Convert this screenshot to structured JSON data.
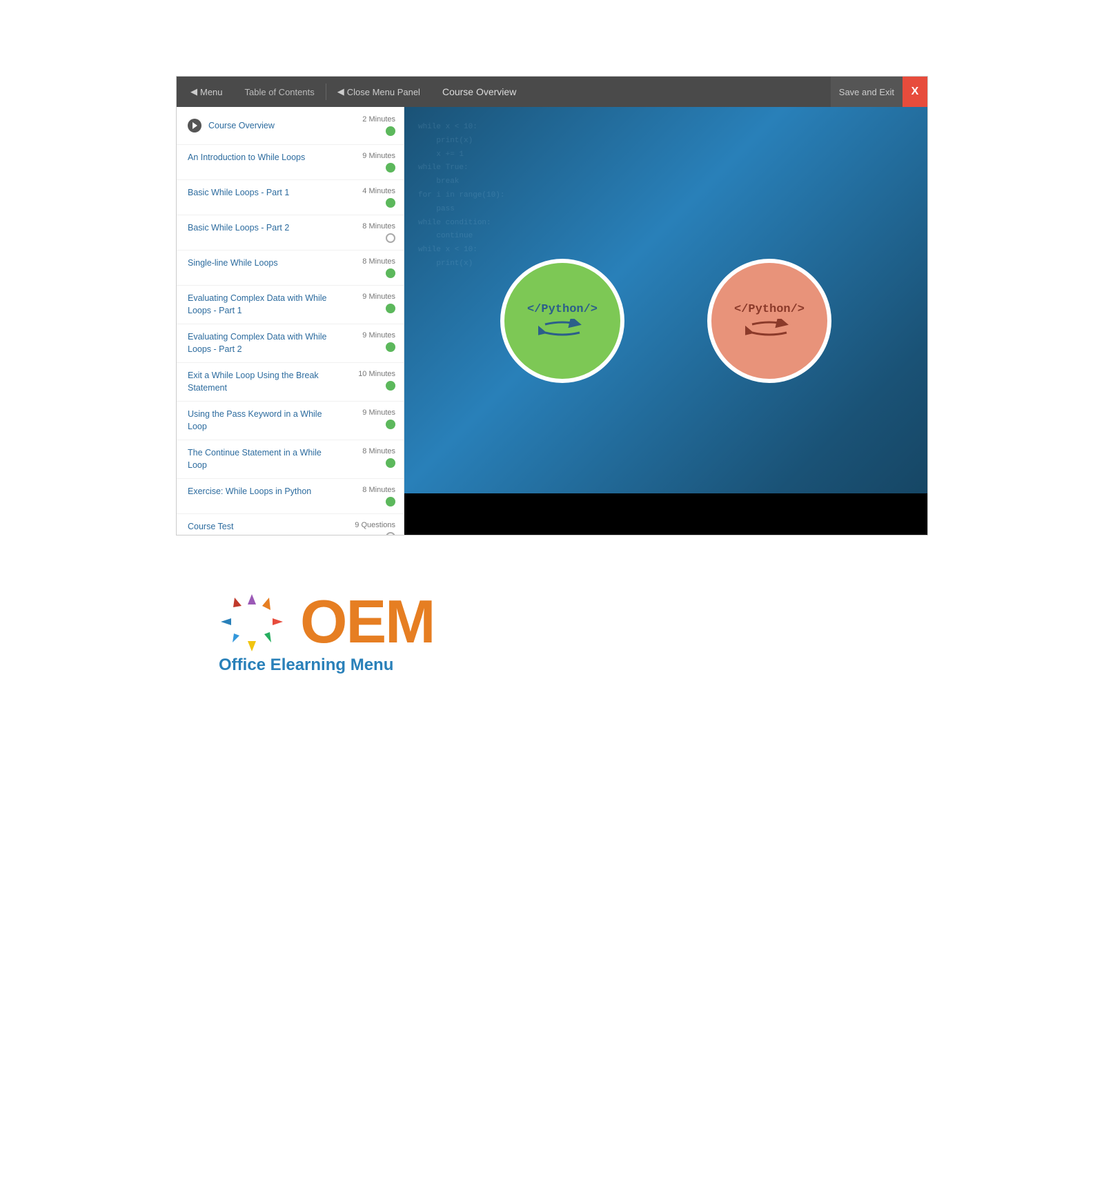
{
  "nav": {
    "menu_label": "Menu",
    "toc_label": "Table of Contents",
    "close_panel_label": "Close Menu Panel",
    "course_overview_label": "Course Overview",
    "save_exit_label": "Save and Exit",
    "close_x_label": "X"
  },
  "sidebar": {
    "items": [
      {
        "id": "course-overview",
        "label": "Course Overview",
        "duration": "2 Minutes",
        "status": "green",
        "active": true
      },
      {
        "id": "intro-while-loops",
        "label": "An Introduction to While Loops",
        "duration": "9 Minutes",
        "status": "green",
        "active": false
      },
      {
        "id": "basic-while-loops-1",
        "label": "Basic While Loops - Part 1",
        "duration": "4 Minutes",
        "status": "green",
        "active": false
      },
      {
        "id": "basic-while-loops-2",
        "label": "Basic While Loops - Part 2",
        "duration": "8 Minutes",
        "status": "empty",
        "active": false
      },
      {
        "id": "single-line-while-loops",
        "label": "Single-line While Loops",
        "duration": "8 Minutes",
        "status": "green",
        "active": false
      },
      {
        "id": "evaluating-complex-1",
        "label": "Evaluating Complex Data with While Loops - Part 1",
        "duration": "9 Minutes",
        "status": "green",
        "active": false
      },
      {
        "id": "evaluating-complex-2",
        "label": "Evaluating Complex Data with While Loops - Part 2",
        "duration": "9 Minutes",
        "status": "green",
        "active": false
      },
      {
        "id": "exit-while-loop-break",
        "label": "Exit a While Loop Using the Break Statement",
        "duration": "10 Minutes",
        "status": "green",
        "active": false
      },
      {
        "id": "pass-keyword",
        "label": "Using the Pass Keyword in a While Loop",
        "duration": "9 Minutes",
        "status": "green",
        "active": false
      },
      {
        "id": "continue-statement",
        "label": "The Continue Statement in a While Loop",
        "duration": "8 Minutes",
        "status": "green",
        "active": false
      },
      {
        "id": "exercise-while-loops",
        "label": "Exercise: While Loops in Python",
        "duration": "8 Minutes",
        "status": "green",
        "active": false
      },
      {
        "id": "course-test",
        "label": "Course Test",
        "duration": "9 Questions",
        "status": "empty",
        "active": false
      }
    ]
  },
  "video": {
    "green_circle_label": "</Python/>",
    "salmon_circle_label": "</Python/>"
  },
  "logo": {
    "oem_text": "OEM",
    "tagline": "Office Elearning Menu"
  },
  "code_lines": [
    "while x < 10:",
    "    print(x)",
    "    x += 1",
    "while True:",
    "    break",
    "for i in range(10):",
    "    pass",
    "while condition:",
    "    continue"
  ]
}
